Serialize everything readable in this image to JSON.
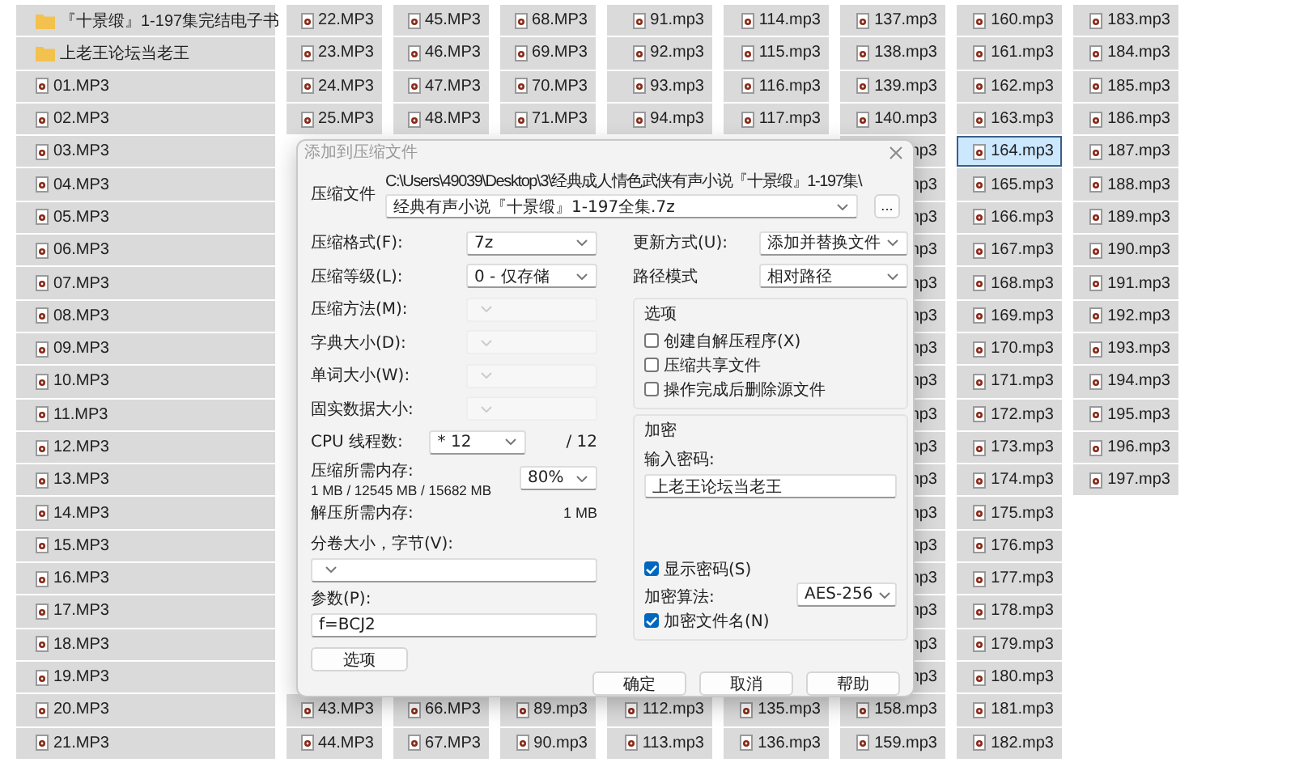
{
  "file_grid": {
    "columns": [
      {
        "items": [
          {
            "name": "『十景缎』1-197集完结电子书",
            "kind": "folder",
            "selected": false
          },
          {
            "name": "上老王论坛当老王",
            "kind": "folder",
            "selected": false
          },
          {
            "name": "01.MP3",
            "kind": "file",
            "selected": false
          },
          {
            "name": "02.MP3",
            "kind": "file",
            "selected": false
          },
          {
            "name": "03.MP3",
            "kind": "file",
            "selected": false
          },
          {
            "name": "04.MP3",
            "kind": "file",
            "selected": false
          },
          {
            "name": "05.MP3",
            "kind": "file",
            "selected": false
          },
          {
            "name": "06.MP3",
            "kind": "file",
            "selected": false
          },
          {
            "name": "07.MP3",
            "kind": "file",
            "selected": false
          },
          {
            "name": "08.MP3",
            "kind": "file",
            "selected": false
          },
          {
            "name": "09.MP3",
            "kind": "file",
            "selected": false
          },
          {
            "name": "10.MP3",
            "kind": "file",
            "selected": false
          },
          {
            "name": "11.MP3",
            "kind": "file",
            "selected": false
          },
          {
            "name": "12.MP3",
            "kind": "file",
            "selected": false
          },
          {
            "name": "13.MP3",
            "kind": "file",
            "selected": false
          },
          {
            "name": "14.MP3",
            "kind": "file",
            "selected": false
          },
          {
            "name": "15.MP3",
            "kind": "file",
            "selected": false
          },
          {
            "name": "16.MP3",
            "kind": "file",
            "selected": false
          },
          {
            "name": "17.MP3",
            "kind": "file",
            "selected": false
          },
          {
            "name": "18.MP3",
            "kind": "file",
            "selected": false
          },
          {
            "name": "19.MP3",
            "kind": "file",
            "selected": false
          },
          {
            "name": "20.MP3",
            "kind": "file",
            "selected": false
          },
          {
            "name": "21.MP3",
            "kind": "file",
            "selected": false
          }
        ]
      },
      {
        "items_top": [
          {
            "name": "22.MP3",
            "kind": "file",
            "selected": false
          },
          {
            "name": "23.MP3",
            "kind": "file",
            "selected": false
          },
          {
            "name": "24.MP3",
            "kind": "file",
            "selected": false
          },
          {
            "name": "25.MP3",
            "kind": "file",
            "selected": false
          }
        ],
        "items_bottom": [
          {
            "name": "43.MP3",
            "kind": "file",
            "selected": false
          },
          {
            "name": "44.MP3",
            "kind": "file",
            "selected": false
          }
        ]
      },
      {
        "items_top": [
          {
            "name": "45.MP3",
            "kind": "file",
            "selected": false
          },
          {
            "name": "46.MP3",
            "kind": "file",
            "selected": false
          },
          {
            "name": "47.MP3",
            "kind": "file",
            "selected": false
          },
          {
            "name": "48.MP3",
            "kind": "file",
            "selected": false
          }
        ],
        "items_bottom": [
          {
            "name": "66.MP3",
            "kind": "file",
            "selected": false
          },
          {
            "name": "67.MP3",
            "kind": "file",
            "selected": false
          }
        ]
      },
      {
        "items_top": [
          {
            "name": "68.MP3",
            "kind": "file",
            "selected": false
          },
          {
            "name": "69.MP3",
            "kind": "file",
            "selected": false
          },
          {
            "name": "70.MP3",
            "kind": "file",
            "selected": false
          },
          {
            "name": "71.MP3",
            "kind": "file",
            "selected": false
          }
        ],
        "items_bottom": [
          {
            "name": "89.mp3",
            "kind": "file",
            "selected": false
          },
          {
            "name": "90.mp3",
            "kind": "file",
            "selected": false
          }
        ]
      },
      {
        "items_top": [
          {
            "name": "91.mp3",
            "kind": "file",
            "selected": false
          },
          {
            "name": "92.mp3",
            "kind": "file",
            "selected": false
          },
          {
            "name": "93.mp3",
            "kind": "file",
            "selected": false
          },
          {
            "name": "94.mp3",
            "kind": "file",
            "selected": false
          }
        ],
        "items_bottom": [
          {
            "name": "112.mp3",
            "kind": "file",
            "selected": false
          },
          {
            "name": "113.mp3",
            "kind": "file",
            "selected": false
          }
        ]
      },
      {
        "items_top": [
          {
            "name": "114.mp3",
            "kind": "file",
            "selected": false
          },
          {
            "name": "115.mp3",
            "kind": "file",
            "selected": false
          },
          {
            "name": "116.mp3",
            "kind": "file",
            "selected": false
          },
          {
            "name": "117.mp3",
            "kind": "file",
            "selected": false
          }
        ],
        "items_bottom": [
          {
            "name": "135.mp3",
            "kind": "file",
            "selected": false
          },
          {
            "name": "136.mp3",
            "kind": "file",
            "selected": false
          }
        ]
      },
      {
        "items": [
          {
            "name": "137.mp3",
            "kind": "file",
            "selected": false
          },
          {
            "name": "138.mp3",
            "kind": "file",
            "selected": false
          },
          {
            "name": "139.mp3",
            "kind": "file",
            "selected": false
          },
          {
            "name": "140.mp3",
            "kind": "file",
            "selected": false
          },
          {
            "name": "np3",
            "kind": "fragment",
            "selected": false
          },
          {
            "name": "np3",
            "kind": "fragment",
            "selected": false
          },
          {
            "name": "np3",
            "kind": "fragment",
            "selected": false
          },
          {
            "name": "np3",
            "kind": "fragment",
            "selected": false
          },
          {
            "name": "np3",
            "kind": "fragment",
            "selected": false
          },
          {
            "name": "np3",
            "kind": "fragment",
            "selected": false
          },
          {
            "name": "np3",
            "kind": "fragment",
            "selected": false
          },
          {
            "name": "np3",
            "kind": "fragment",
            "selected": false
          },
          {
            "name": "np3",
            "kind": "fragment",
            "selected": false
          },
          {
            "name": "np3",
            "kind": "fragment",
            "selected": false
          },
          {
            "name": "np3",
            "kind": "fragment",
            "selected": false
          },
          {
            "name": "np3",
            "kind": "fragment",
            "selected": false
          },
          {
            "name": "np3",
            "kind": "fragment",
            "selected": false
          },
          {
            "name": "np3",
            "kind": "fragment",
            "selected": false
          },
          {
            "name": "np3",
            "kind": "fragment",
            "selected": false
          },
          {
            "name": "np3",
            "kind": "fragment",
            "selected": false
          },
          {
            "name": "np3",
            "kind": "fragment",
            "selected": false
          },
          {
            "name": "158.mp3",
            "kind": "file",
            "selected": false
          },
          {
            "name": "159.mp3",
            "kind": "file",
            "selected": false
          }
        ]
      },
      {
        "items": [
          {
            "name": "160.mp3",
            "kind": "file",
            "selected": false
          },
          {
            "name": "161.mp3",
            "kind": "file",
            "selected": false
          },
          {
            "name": "162.mp3",
            "kind": "file",
            "selected": false
          },
          {
            "name": "163.mp3",
            "kind": "file",
            "selected": false
          },
          {
            "name": "164.mp3",
            "kind": "file",
            "selected": true
          },
          {
            "name": "165.mp3",
            "kind": "file",
            "selected": false
          },
          {
            "name": "166.mp3",
            "kind": "file",
            "selected": false
          },
          {
            "name": "167.mp3",
            "kind": "file",
            "selected": false
          },
          {
            "name": "168.mp3",
            "kind": "file",
            "selected": false
          },
          {
            "name": "169.mp3",
            "kind": "file",
            "selected": false
          },
          {
            "name": "170.mp3",
            "kind": "file",
            "selected": false
          },
          {
            "name": "171.mp3",
            "kind": "file",
            "selected": false
          },
          {
            "name": "172.mp3",
            "kind": "file",
            "selected": false
          },
          {
            "name": "173.mp3",
            "kind": "file",
            "selected": false
          },
          {
            "name": "174.mp3",
            "kind": "file",
            "selected": false
          },
          {
            "name": "175.mp3",
            "kind": "file",
            "selected": false
          },
          {
            "name": "176.mp3",
            "kind": "file",
            "selected": false
          },
          {
            "name": "177.mp3",
            "kind": "file",
            "selected": false
          },
          {
            "name": "178.mp3",
            "kind": "file",
            "selected": false
          },
          {
            "name": "179.mp3",
            "kind": "file",
            "selected": false
          },
          {
            "name": "180.mp3",
            "kind": "file",
            "selected": false
          },
          {
            "name": "181.mp3",
            "kind": "file",
            "selected": false
          },
          {
            "name": "182.mp3",
            "kind": "file",
            "selected": false
          }
        ]
      },
      {
        "items": [
          {
            "name": "183.mp3",
            "kind": "file",
            "selected": false
          },
          {
            "name": "184.mp3",
            "kind": "file",
            "selected": false
          },
          {
            "name": "185.mp3",
            "kind": "file",
            "selected": false
          },
          {
            "name": "186.mp3",
            "kind": "file",
            "selected": false
          },
          {
            "name": "187.mp3",
            "kind": "file",
            "selected": false
          },
          {
            "name": "188.mp3",
            "kind": "file",
            "selected": false
          },
          {
            "name": "189.mp3",
            "kind": "file",
            "selected": false
          },
          {
            "name": "190.mp3",
            "kind": "file",
            "selected": false
          },
          {
            "name": "191.mp3",
            "kind": "file",
            "selected": false
          },
          {
            "name": "192.mp3",
            "kind": "file",
            "selected": false
          },
          {
            "name": "193.mp3",
            "kind": "file",
            "selected": false
          },
          {
            "name": "194.mp3",
            "kind": "file",
            "selected": false
          },
          {
            "name": "195.mp3",
            "kind": "file",
            "selected": false
          },
          {
            "name": "196.mp3",
            "kind": "file",
            "selected": false
          },
          {
            "name": "197.mp3",
            "kind": "file",
            "selected": false
          }
        ]
      }
    ]
  },
  "dialog": {
    "title": "添加到压缩文件",
    "archive": {
      "label": "压缩文件",
      "path": "C:\\Users\\49039\\Desktop\\3\\经典成人情色武侠有声小说『十景缎』1-197集\\",
      "value": "经典有声小说『十景缎』1-197全集.7z",
      "browse": "..."
    },
    "left_fields": [
      {
        "kind": "combo",
        "label": "压缩格式(F):",
        "value": "7z",
        "disabled": false
      },
      {
        "kind": "combo",
        "label": "压缩等级(L):",
        "value": "0 - 仅存储",
        "disabled": false
      },
      {
        "kind": "combo",
        "label": "压缩方法(M):",
        "disabled": true
      },
      {
        "kind": "combo",
        "label": "字典大小(D):",
        "disabled": true
      },
      {
        "kind": "combo",
        "label": "单词大小(W):",
        "disabled": true
      },
      {
        "kind": "combo",
        "label": "固实数据大小:",
        "disabled": true
      },
      {
        "kind": "combo",
        "label": "CPU 线程数:",
        "value": "* 12",
        "suffix": "/ 12",
        "disabled": false
      },
      {
        "kind": "memory",
        "label": "压缩所需内存:",
        "detail": "1 MB / 12545 MB / 15682 MB",
        "value": "80%",
        "disabled": false
      },
      {
        "kind": "info",
        "label": "解压所需内存:",
        "value": "1 MB"
      }
    ],
    "volume": {
      "label": "分卷大小，字节(V):"
    },
    "params": {
      "label": "参数(P):",
      "value": "f=BCJ2"
    },
    "options_button": "选项",
    "right_fields": [
      {
        "label": "更新方式(U):",
        "value": "添加并替换文件"
      },
      {
        "label": "路径模式",
        "value": "相对路径"
      }
    ],
    "options_group": {
      "title": "选项",
      "checkboxes": [
        {
          "label": "创建自解压程序(X)",
          "checked": false
        },
        {
          "label": "压缩共享文件",
          "checked": false
        },
        {
          "label": "操作完成后删除源文件",
          "checked": false
        }
      ]
    },
    "encryption": {
      "title": "加密",
      "password_label": "输入密码:",
      "password": "上老王论坛当老王",
      "show_password": {
        "label": "显示密码(S)",
        "checked": true
      },
      "method_label": "加密算法:",
      "method": "AES-256",
      "encrypt_names": {
        "label": "加密文件名(N)",
        "checked": true
      }
    },
    "buttons": [
      "确定",
      "取消",
      "帮助"
    ]
  }
}
